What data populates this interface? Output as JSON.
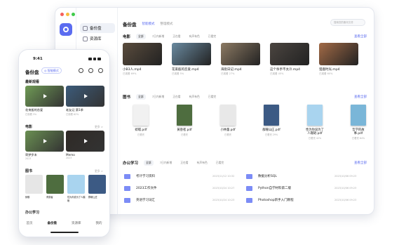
{
  "window_dots": [
    "#f5605c",
    "#f8bd3c",
    "#3fcb4a"
  ],
  "accent": "#5b6cf0",
  "desktop": {
    "sidebar": [
      {
        "label": "备份盘",
        "icon": "backup-icon"
      },
      {
        "label": "资源库",
        "icon": "library-icon"
      }
    ],
    "title": "备份盘",
    "tabs": [
      "智能模式",
      "整理模式"
    ],
    "search_placeholder": "搜索您的备份文件",
    "more_label": "查看全部",
    "video": {
      "title": "电影",
      "chips": [
        "全部",
        "7日内新增",
        "正在看",
        "有声有色",
        "已看完"
      ],
      "items": [
        {
          "name": "小B3人.mp4",
          "meta": "已观看 69%",
          "color": "#5a4c3d"
        },
        {
          "name": "花束般的恋爱.mp4",
          "meta": "已观看 5%",
          "color": "#6a8aa0"
        },
        {
          "name": "海街日记.mp4",
          "meta": "已观看 27%",
          "color": "#8c7a63"
        },
        {
          "name": "这个杀手不太冷.mp4",
          "meta": "已观看 45%",
          "color": "#4b4540"
        },
        {
          "name": "猎鹿时光.mp4",
          "meta": "已观看 60%",
          "color": "#a26a46"
        }
      ]
    },
    "books": {
      "title": "图书",
      "chips": [
        "全部",
        "7日内新增",
        "正在看",
        "有声有色",
        "已看完"
      ],
      "items": [
        {
          "name": "蜉蝣.pdf",
          "meta": "已看完",
          "color": "#f1f1f1"
        },
        {
          "name": "黄昏者.pdf",
          "meta": "已看完",
          "color": "#4e6d3f"
        },
        {
          "name": "小林童.pdf",
          "meta": "已看完",
          "color": "#e8e8e8"
        },
        {
          "name": "群曜山庄.pdf",
          "meta": "已看完 29%",
          "color": "#3c5a84"
        },
        {
          "name": "性为你说为了人踹砸.pdf",
          "meta": "已看完 42%",
          "color": "#a9d4ef"
        },
        {
          "name": "哲学的故事.pdf",
          "meta": "已看完 64%",
          "color": "#7ab6d8"
        }
      ]
    },
    "office": {
      "title": "办公学习",
      "chips": [
        "全部",
        "7日内新增",
        "正在看",
        "有声有色",
        "已看完"
      ],
      "left": [
        {
          "name": "考计学习资料",
          "date": "2023/11/12 10:32"
        },
        {
          "name": "2023工作文件",
          "date": "2023/10/24 10:27"
        },
        {
          "name": "英语学习词汇",
          "date": "2023/10/24 10:23"
        }
      ],
      "right": [
        {
          "name": "数据分析SQL",
          "date": "2023/10/06 09:23"
        },
        {
          "name": "Python自学材料第二版",
          "date": "2023/10/06 09:23"
        },
        {
          "name": "Photoshop新手入门教程",
          "date": "2023/10/06 09:23"
        }
      ]
    }
  },
  "phone": {
    "time": "9:41",
    "title": "备份盘",
    "badge": "◎ 智能模式",
    "sections": {
      "recent": "最新观看",
      "movies": "电影",
      "books": "图书",
      "office": "办公学习"
    },
    "more": "更多 >",
    "recent": [
      {
        "name": "花束般的恋爱",
        "meta": "已观看 5%",
        "color": "#6f9a55"
      },
      {
        "name": "老友记 第1季",
        "meta": "已观看 62%",
        "color": "#3c5b7a"
      }
    ],
    "movies": [
      {
        "name": "寄梦岁末",
        "meta": "2023",
        "color": "#6a8f52"
      },
      {
        "name": "Memo",
        "meta": "2023",
        "color": "#2f2a26"
      }
    ],
    "books": [
      {
        "name": "蜉蝣",
        "color": "#e6e6e6"
      },
      {
        "name": "黄昏者",
        "color": "#4e6d3f"
      },
      {
        "name": "性为你说为了人踹砸",
        "color": "#a9d4ef"
      },
      {
        "name": "群曜山庄",
        "color": "#3c5a84"
      }
    ],
    "nav": [
      "首页",
      "备份盘",
      "资源库",
      "我的"
    ]
  }
}
